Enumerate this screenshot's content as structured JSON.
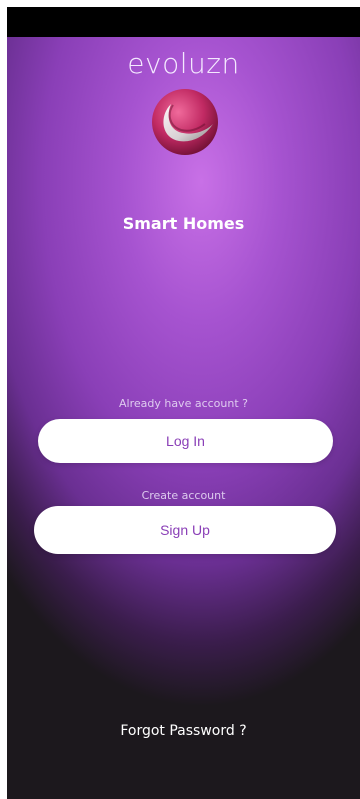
{
  "app": {
    "brand": "evoluzn",
    "tagline": "Smart Homes",
    "logo_icon": "evoluzn-logo-icon"
  },
  "auth": {
    "login_hint": "Already have account ?",
    "login_label": "Log In",
    "signup_hint": "Create account",
    "signup_label": "Sign Up",
    "forgot_label": "Forgot Password ?"
  },
  "colors": {
    "accent": "#8a3fb7",
    "gradient_top": "#c870e6",
    "background_dark": "#1c181d",
    "button_bg": "#ffffff"
  }
}
